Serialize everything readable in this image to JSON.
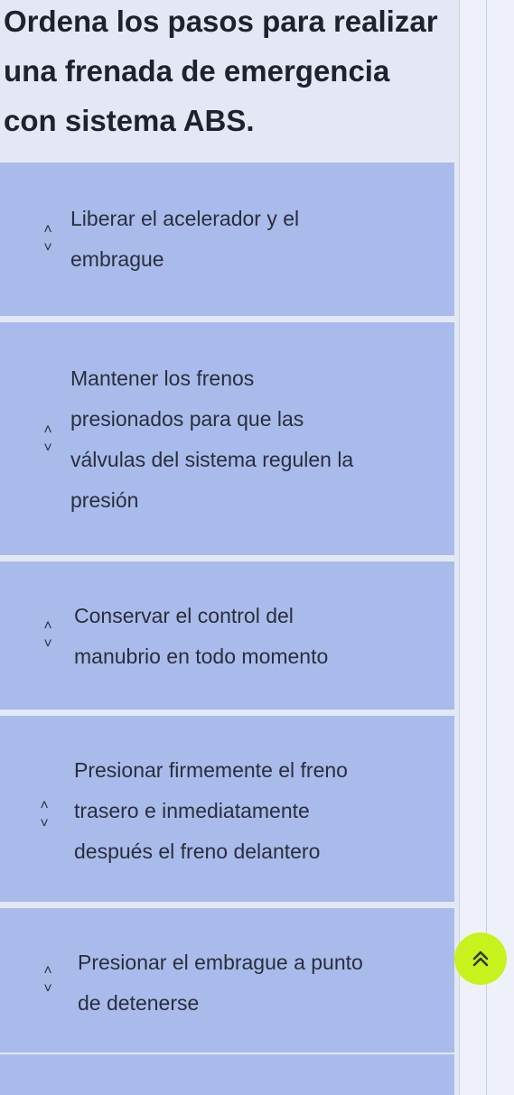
{
  "question": {
    "line1": "Ordena los pasos para realizar",
    "line2": "una frenada de emergencia",
    "line3": "con sistema ABS."
  },
  "items": [
    {
      "lines": [
        "Liberar el acelerador y el",
        "embrague"
      ]
    },
    {
      "lines": [
        "Mantener los frenos",
        "presionados para que las",
        "válvulas del sistema regulen la",
        "presión"
      ]
    },
    {
      "lines": [
        "Conservar el control del",
        "manubrio en todo momento"
      ]
    },
    {
      "lines": [
        "Presionar firmemente el freno",
        "trasero e inmediatamente",
        "después el freno delantero"
      ]
    },
    {
      "lines": [
        "Presionar el embrague a punto",
        "de detenerse"
      ]
    }
  ],
  "icons": {
    "move_up": "chevron-up-icon",
    "move_down": "chevron-down-icon",
    "scroll_top": "double-chevron-up-icon"
  },
  "colors": {
    "item_background": "#a9bbea",
    "page_background": "#e4e8f6",
    "scroll_button": "#c8f21c"
  }
}
